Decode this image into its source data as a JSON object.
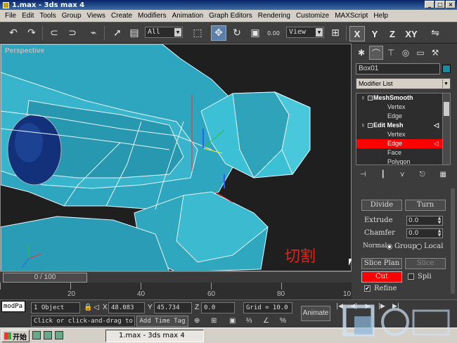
{
  "window": {
    "title": "1.max - 3ds max 4",
    "min": "_",
    "max": "□",
    "close": "×"
  },
  "menu": [
    "File",
    "Edit",
    "Tools",
    "Group",
    "Views",
    "Create",
    "Modifiers",
    "Animation",
    "Graph Editors",
    "Rendering",
    "Customize",
    "MAXScript",
    "Help"
  ],
  "toolbar": {
    "selection_filter": "All",
    "ref_coord": "View",
    "axes": [
      "X",
      "Y",
      "Z",
      "XY"
    ],
    "spinner_value": "0.00"
  },
  "viewport": {
    "label": "Perspective",
    "annotation": "切割"
  },
  "command_panel": {
    "object_name": "Box01",
    "object_color": "#1d8a9e",
    "modifier_list": "Modifier List",
    "stack": [
      {
        "label": "MeshSmooth",
        "level": "top"
      },
      {
        "label": "Vertex",
        "level": "sub"
      },
      {
        "label": "Edge",
        "level": "sub"
      },
      {
        "label": "Edit Mesh",
        "level": "top"
      },
      {
        "label": "Vertex",
        "level": "sub"
      },
      {
        "label": "Edge",
        "level": "sub",
        "selected": true
      },
      {
        "label": "Face",
        "level": "sub"
      },
      {
        "label": "Polygon",
        "level": "sub"
      }
    ],
    "rollout": {
      "divide": "Divide",
      "turn": "Turn",
      "extrude_label": "Extrude",
      "extrude_value": "0.0",
      "chamfer_label": "Chamfer",
      "chamfer_value": "0.0",
      "normal_label": "Normal",
      "group_label": "Group",
      "local_label": "Local",
      "slice_plane": "Slice Plan",
      "slice": "Slice",
      "cut": "Cut",
      "split": "Spli",
      "refine": "Refine"
    }
  },
  "time": {
    "slider": "0 / 100",
    "ticks": [
      "20",
      "40",
      "60",
      "80",
      "10"
    ]
  },
  "status": {
    "mode": "modPa",
    "selection": "1 Object",
    "x_label": "X",
    "x_value": "48.083",
    "y_label": "Y",
    "y_value": "45.734",
    "z_label": "Z",
    "z_value": "0.0",
    "grid": "Grid = 10.0",
    "animate": "Animate",
    "prompt": "Click or click-and-drag to",
    "add_time_tag": "Add Time Tag"
  },
  "taskbar": {
    "start": "开始",
    "task": "1.max - 3ds max 4"
  },
  "accent": "#ff0000"
}
